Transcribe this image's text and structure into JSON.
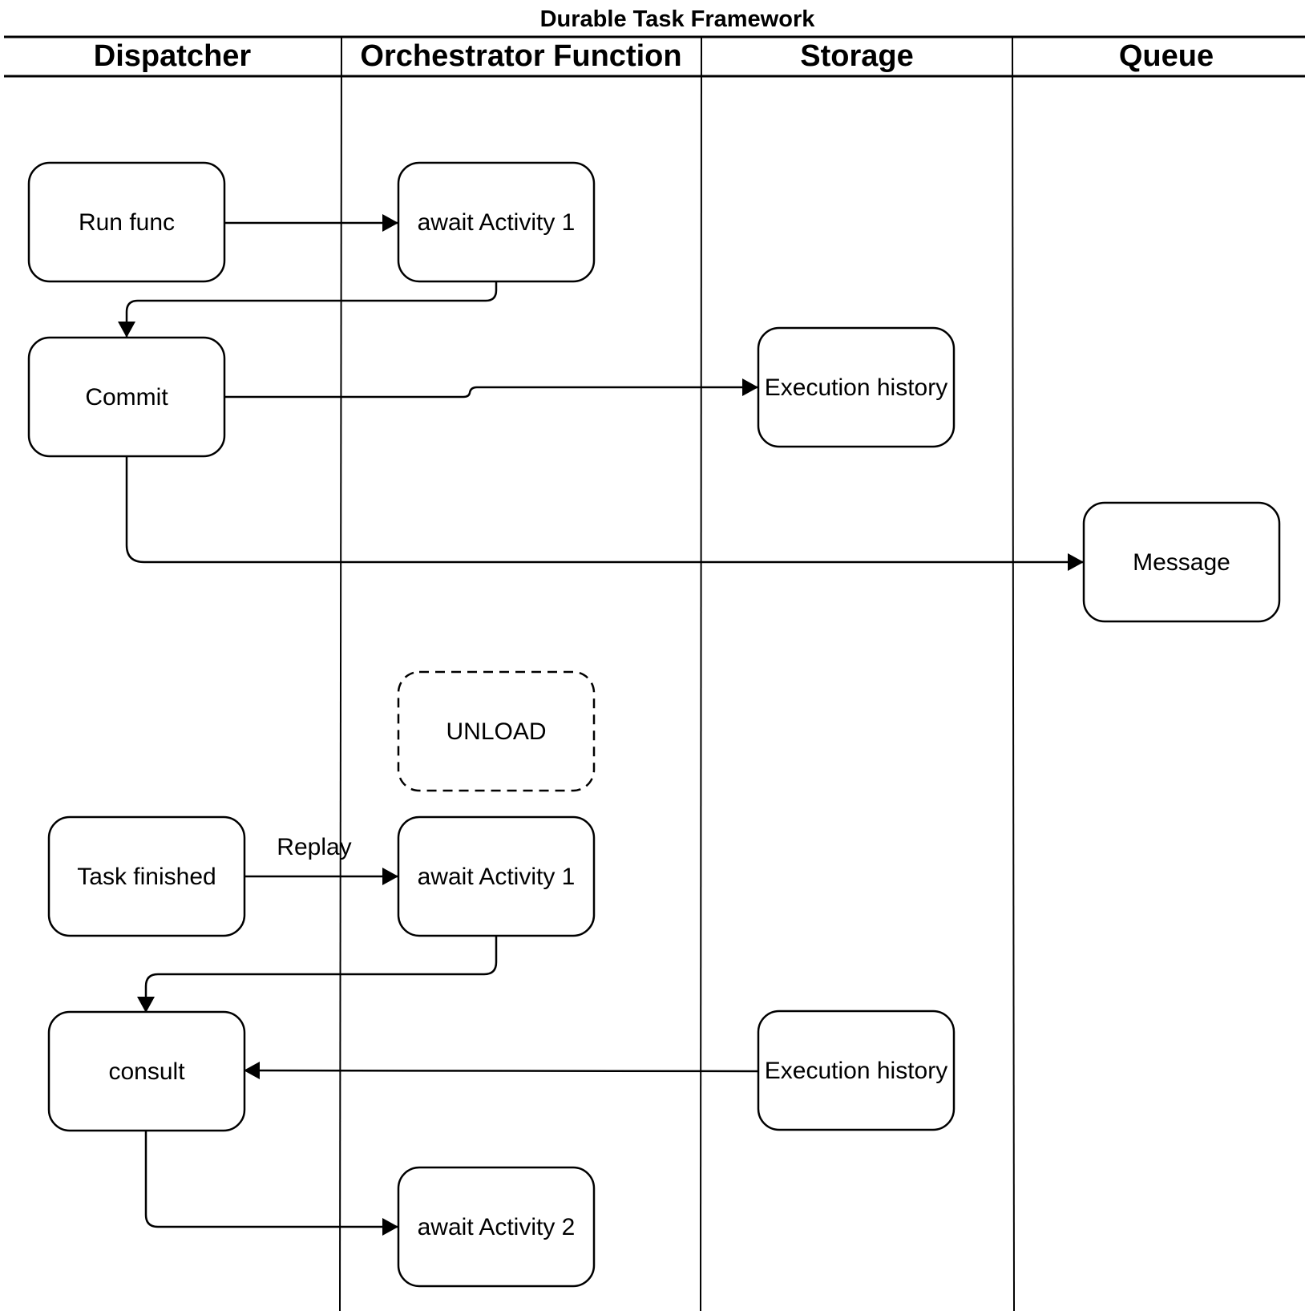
{
  "title": "Durable Task Framework",
  "lanes": [
    {
      "name": "Dispatcher"
    },
    {
      "name": "Orchestrator Function"
    },
    {
      "name": "Storage"
    },
    {
      "name": "Queue"
    }
  ],
  "nodes": [
    {
      "id": "run-func",
      "label": "Run func",
      "lane": "Dispatcher",
      "style": "solid"
    },
    {
      "id": "await-activity-1-first",
      "label": "await Activity 1",
      "lane": "Orchestrator Function",
      "style": "solid"
    },
    {
      "id": "commit",
      "label": "Commit",
      "lane": "Dispatcher",
      "style": "solid"
    },
    {
      "id": "execution-history-write",
      "label": "Execution history",
      "lane": "Storage",
      "style": "solid"
    },
    {
      "id": "message",
      "label": "Message",
      "lane": "Queue",
      "style": "solid"
    },
    {
      "id": "unload",
      "label": "UNLOAD",
      "lane": "Orchestrator Function",
      "style": "dashed"
    },
    {
      "id": "task-finished",
      "label": "Task finished",
      "lane": "Dispatcher",
      "style": "solid"
    },
    {
      "id": "await-activity-1-replay",
      "label": "await Activity 1",
      "lane": "Orchestrator Function",
      "style": "solid"
    },
    {
      "id": "consult",
      "label": "consult",
      "lane": "Dispatcher",
      "style": "solid"
    },
    {
      "id": "execution-history-read",
      "label": "Execution history",
      "lane": "Storage",
      "style": "solid"
    },
    {
      "id": "await-activity-2",
      "label": "await Activity 2",
      "lane": "Orchestrator Function",
      "style": "solid"
    }
  ],
  "edges": [
    {
      "from": "run-func",
      "to": "await-activity-1-first",
      "label": ""
    },
    {
      "from": "await-activity-1-first",
      "to": "commit",
      "label": ""
    },
    {
      "from": "commit",
      "to": "execution-history-write",
      "label": ""
    },
    {
      "from": "commit",
      "to": "message",
      "label": ""
    },
    {
      "from": "task-finished",
      "to": "await-activity-1-replay",
      "label": "Replay"
    },
    {
      "from": "await-activity-1-replay",
      "to": "consult",
      "label": ""
    },
    {
      "from": "execution-history-read",
      "to": "consult",
      "label": ""
    },
    {
      "from": "consult",
      "to": "await-activity-2",
      "label": ""
    }
  ]
}
